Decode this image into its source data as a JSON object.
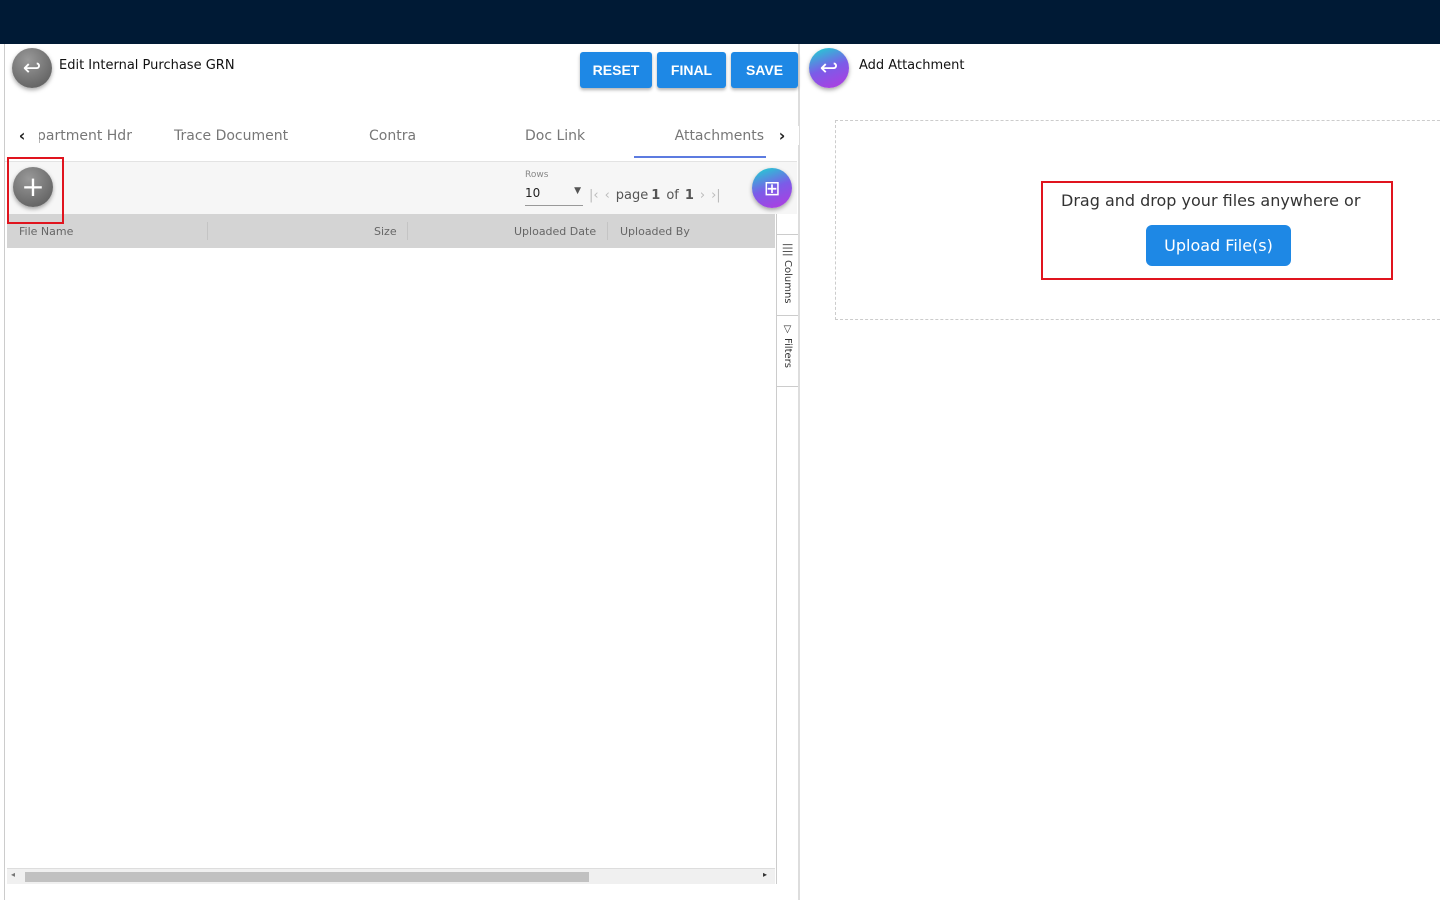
{
  "header": {
    "title": "Edit Internal Purchase GRN",
    "buttons": {
      "reset": "RESET",
      "final": "FINAL",
      "save": "SAVE"
    }
  },
  "tabs": [
    {
      "label": "Department Hdr",
      "visible": "partment Hdr"
    },
    {
      "label": "Trace Document"
    },
    {
      "label": "Contra"
    },
    {
      "label": "Doc Link"
    },
    {
      "label": "Attachments",
      "active": true
    }
  ],
  "pager": {
    "rows_label": "Rows",
    "rows_value": "10",
    "page_label": "page",
    "page": "1",
    "of_label": "of",
    "total": "1"
  },
  "table": {
    "columns": [
      "File Name",
      "Size",
      "Uploaded Date",
      "Uploaded By"
    ],
    "rows": []
  },
  "side_panel": {
    "columns": "Columns",
    "filters": "Filters"
  },
  "attachment": {
    "title": "Add Attachment",
    "drop_text": "Drag and drop your files anywhere or",
    "upload_label": "Upload File(s)"
  },
  "colors": {
    "topbar": "#001a35",
    "accent": "#1e88e5",
    "highlight": "#e0141e"
  }
}
